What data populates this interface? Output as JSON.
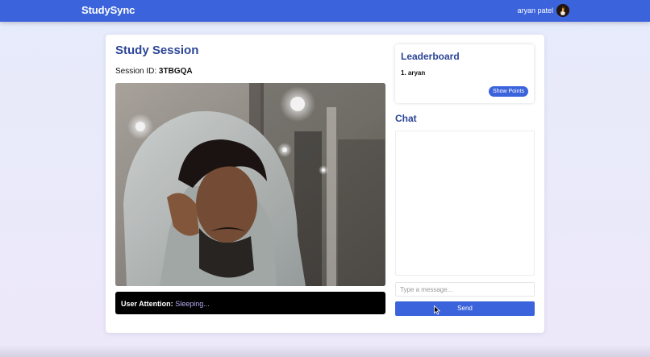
{
  "app": {
    "brand": "StudySync",
    "user_name": "aryan patel",
    "avatar_icon": "user-avatar-icon"
  },
  "session": {
    "title": "Study Session",
    "id_label": "Session ID:",
    "id_value": "3TBGQA"
  },
  "video": {
    "feed_icon": "webcam-feed-image"
  },
  "attention": {
    "label": "User Attention:",
    "status": "Sleeping..."
  },
  "leaderboard": {
    "title": "Leaderboard",
    "entries": [
      {
        "rank_name": "1. aryan"
      }
    ],
    "show_points_label": "Show Points"
  },
  "chat": {
    "title": "Chat",
    "input_placeholder": "Type a message...",
    "send_label": "Send"
  },
  "colors": {
    "accent": "#3b63dc",
    "heading": "#2c4596",
    "attention_status": "#b9a8f2"
  }
}
